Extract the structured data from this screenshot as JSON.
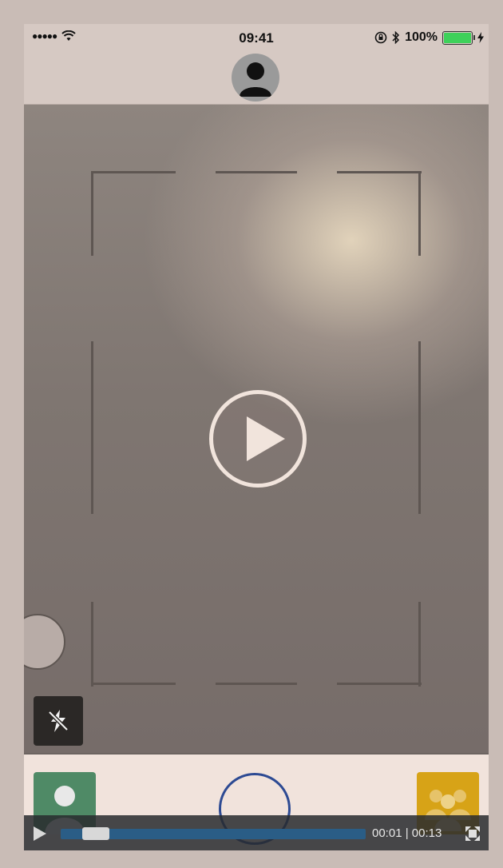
{
  "status_bar": {
    "signal_dots": "●●●●●",
    "time": "09:41",
    "battery_percent": "100%",
    "icons": [
      "wifi-icon",
      "orientation-lock-icon",
      "bluetooth-icon",
      "battery-icon",
      "charging-bolt-icon"
    ]
  },
  "header": {
    "avatar_icon": "user-avatar-icon"
  },
  "camera": {
    "play_icon": "play-icon",
    "flash_icon": "flash-off-icon"
  },
  "bottom_bar": {
    "contacts_icon": "contact-person-icon",
    "group_icon": "group-people-icon",
    "shutter_icon": "shutter-circle-icon",
    "colors": {
      "contacts_bg": "#4f8a66",
      "group_bg": "#d7a317",
      "shutter_ring": "#2d4a93"
    }
  },
  "video_player": {
    "current_time": "00:01",
    "separator": "|",
    "duration": "00:13",
    "progress_fraction": 0.077,
    "track_color": "#2a5d86"
  }
}
